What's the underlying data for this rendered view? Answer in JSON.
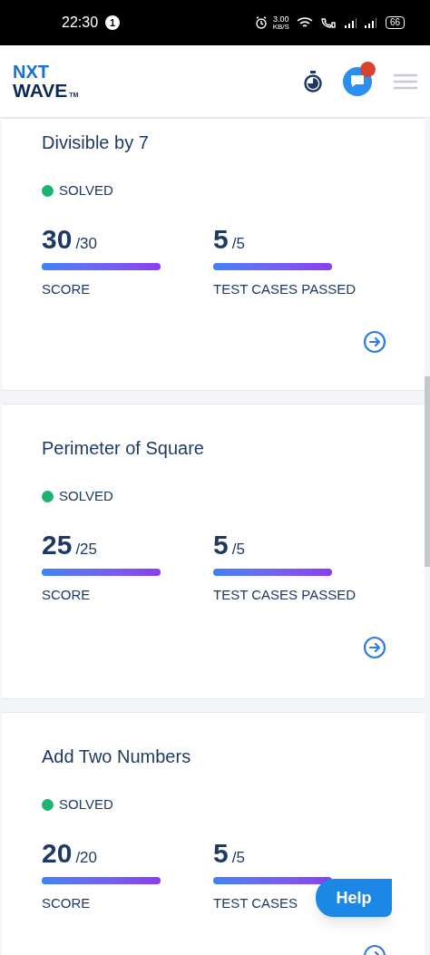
{
  "status_bar": {
    "time": "22:30",
    "notification_count": "1",
    "speed_value": "3.00",
    "speed_unit": "KB/S",
    "battery": "66"
  },
  "header": {
    "logo_top": "NXT",
    "logo_bottom": "WAVE",
    "logo_mark": "TM",
    "chat_badge": true
  },
  "cards": [
    {
      "title": "Divisible by 7",
      "status": "SOLVED",
      "color": "#1db46f",
      "metrics": [
        {
          "value": "30",
          "total": "/30",
          "label": "SCORE",
          "level": 1
        },
        {
          "value": "5",
          "total": "/5",
          "label": "TEST CASES PASSED",
          "level": 1
        }
      ]
    },
    {
      "title": "Perimeter of Square",
      "status": "SOLVED",
      "color": "#1db46f",
      "metrics": [
        {
          "value": "25",
          "total": "/25",
          "label": "SCORE",
          "level": 1
        },
        {
          "value": "5",
          "total": "/5",
          "label": "TEST CASES PASSED",
          "level": 1
        }
      ]
    },
    {
      "title": "Add Two Numbers",
      "status": "SOLVED",
      "color": "#1db46f",
      "metrics": [
        {
          "value": "20",
          "total": "/20",
          "label": "SCORE",
          "level": 1
        },
        {
          "value": "5",
          "total": "/5",
          "label": "TEST CASES",
          "level": 1
        }
      ]
    }
  ],
  "help_button": "Help"
}
